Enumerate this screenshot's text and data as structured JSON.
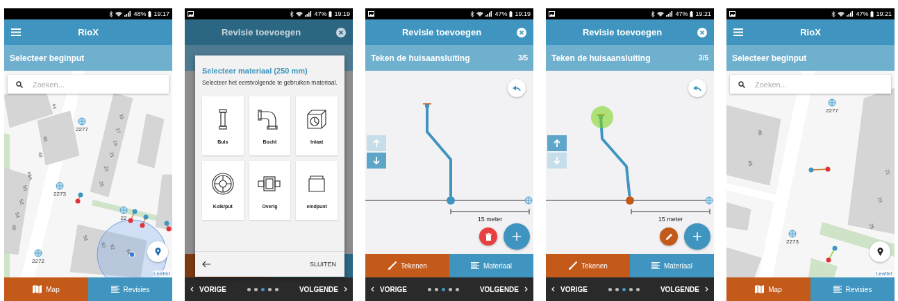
{
  "screens": [
    {
      "kind": "map",
      "status": {
        "gallery_notification": false,
        "battery": "48%",
        "time": "19:17"
      },
      "app_bar": {
        "title": "RioX"
      },
      "step": {
        "title": "Selecteer beginput"
      },
      "search": {
        "placeholder": "Zoeken..."
      },
      "house_numbers": [
        "44",
        "46",
        "48",
        "15",
        "17",
        "19",
        "21",
        "23",
        "25",
        "48A",
        "50",
        "52",
        "54",
        "56",
        "58",
        "60",
        "62",
        "64"
      ],
      "manholes": [
        "2277",
        "2273",
        "2272",
        "22"
      ],
      "attribution": "Leaflet",
      "tabs": [
        {
          "label": "Map",
          "selected": true
        },
        {
          "label": "Revisies",
          "selected": false
        }
      ]
    },
    {
      "kind": "dialog",
      "status": {
        "gallery_notification": true,
        "battery": "47%",
        "time": "19:19"
      },
      "app_bar": {
        "title": "Revisie toevoegen"
      },
      "dialog": {
        "title": "Selecteer materiaal (250 mm)",
        "text": "Selecteer het eerstvolgende te gebruiken materiaal.",
        "materials": [
          {
            "label": "Buis",
            "kind": "pipe"
          },
          {
            "label": "Bocht",
            "kind": "elbow"
          },
          {
            "label": "Inlaat",
            "kind": "inlet"
          },
          {
            "label": "Kolk/put",
            "kind": "manhole"
          },
          {
            "label": "Overig",
            "kind": "coupling"
          },
          {
            "label": "eindpunt",
            "kind": "cap"
          }
        ],
        "close": "SLUITEN"
      },
      "nav": {
        "prev": "VORIGE",
        "next": "VOLGENDE",
        "steps": [
          {
            "selected": false
          },
          {
            "selected": false
          },
          {
            "selected": true
          },
          {
            "selected": false
          },
          {
            "selected": false
          }
        ]
      }
    },
    {
      "kind": "draw",
      "status": {
        "gallery_notification": true,
        "battery": "47%",
        "time": "19:19"
      },
      "app_bar": {
        "title": "Revisie toevoegen"
      },
      "step": {
        "title": "Teken de huisaansluiting",
        "counter": "3/5"
      },
      "canvas": {
        "up_enabled": false,
        "down_enabled": true,
        "end_selected": false,
        "junction_selected": false,
        "scale": "15 meter"
      },
      "tabs": [
        {
          "label": "Tekenen",
          "selected": true
        },
        {
          "label": "Materiaal",
          "selected": false
        }
      ],
      "nav": {
        "prev": "VORIGE",
        "next": "VOLGENDE",
        "steps": [
          {
            "selected": false
          },
          {
            "selected": false
          },
          {
            "selected": true
          },
          {
            "selected": false
          },
          {
            "selected": false
          }
        ]
      }
    },
    {
      "kind": "draw",
      "status": {
        "gallery_notification": true,
        "battery": "47%",
        "time": "19:21"
      },
      "app_bar": {
        "title": "Revisie toevoegen"
      },
      "step": {
        "title": "Teken de huisaansluiting",
        "counter": "3/5"
      },
      "canvas": {
        "up_enabled": true,
        "down_enabled": false,
        "end_selected": true,
        "junction_selected": true,
        "scale": "15 meter"
      },
      "tabs": [
        {
          "label": "Tekenen",
          "selected": true
        },
        {
          "label": "Materiaal",
          "selected": false
        }
      ],
      "nav": {
        "prev": "VORIGE",
        "next": "VOLGENDE",
        "steps": [
          {
            "selected": false
          },
          {
            "selected": false
          },
          {
            "selected": true
          },
          {
            "selected": false
          },
          {
            "selected": false
          }
        ]
      }
    },
    {
      "kind": "map",
      "status": {
        "gallery_notification": true,
        "battery": "47%",
        "time": "19:21"
      },
      "app_bar": {
        "title": "RioX"
      },
      "step": {
        "title": "Selecteer beginput"
      },
      "search": {
        "placeholder": "Zoeken..."
      },
      "house_numbers": [
        "46",
        "48",
        "21",
        "23",
        "25"
      ],
      "manholes": [
        "2277",
        "2273"
      ],
      "attribution": "Leaflet",
      "tabs": [
        {
          "label": "Map",
          "selected": true
        },
        {
          "label": "Revisies",
          "selected": false
        }
      ]
    }
  ]
}
